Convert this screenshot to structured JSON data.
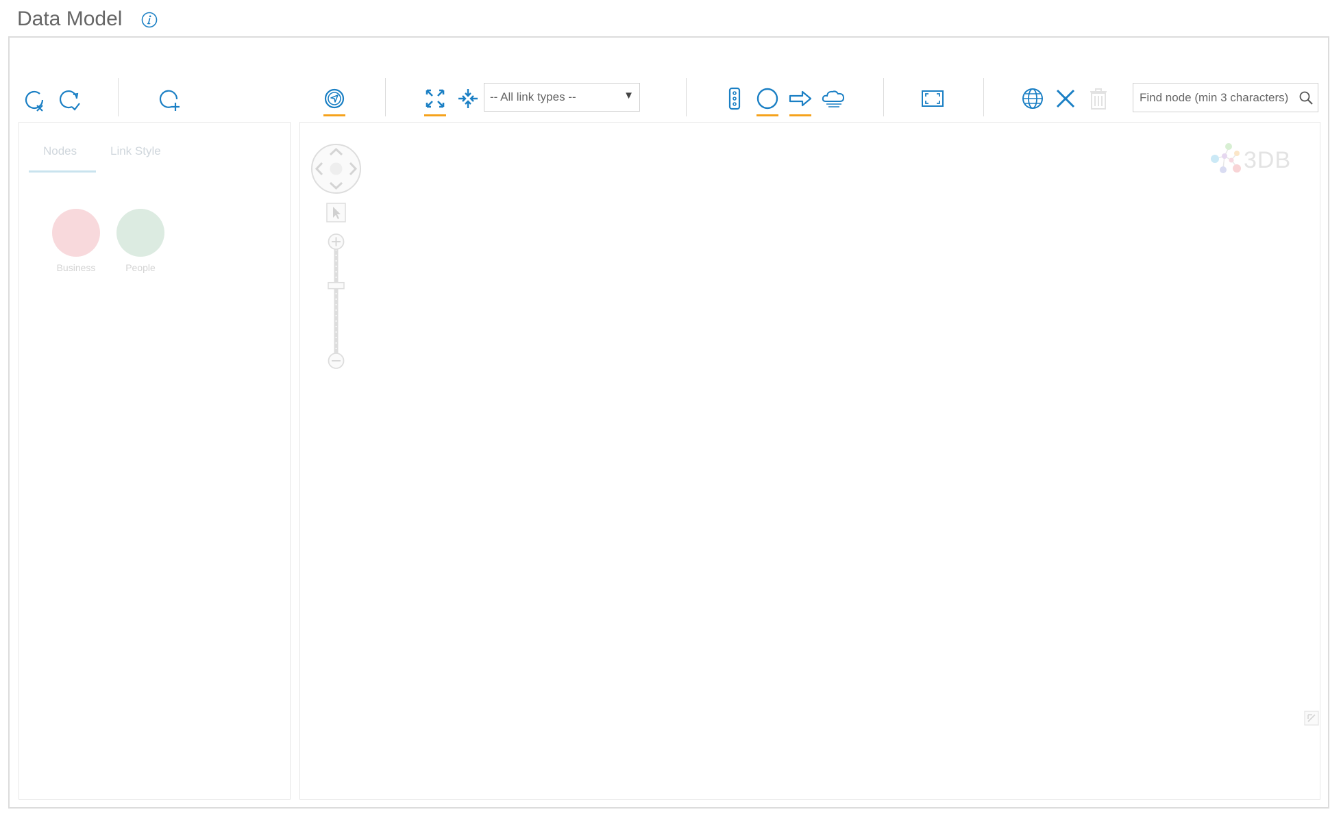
{
  "header": {
    "title": "Data Model",
    "info_icon": "info-icon"
  },
  "colors": {
    "icon_blue": "#1a7fc4",
    "active_underline": "#f5a21b",
    "border": "#dcdcdc",
    "business_node": "#f8d9dc",
    "people_node": "#dcebe1"
  },
  "toolbar": {
    "icons": [
      "deselect-all-icon",
      "select-all-icon",
      "add-node-icon",
      "navigate-icon",
      "expand-icon",
      "collapse-icon",
      "properties-panel-icon",
      "node-shape-icon",
      "link-arrow-icon",
      "cloud-icon",
      "fullscreen-icon",
      "globe-icon",
      "close-icon",
      "delete-icon"
    ],
    "link_type_select": {
      "selected": "--  All link types  --"
    },
    "search": {
      "placeholder": "Find node (min 3 characters)"
    }
  },
  "left_panel": {
    "tabs": [
      {
        "label": "Nodes",
        "active": true
      },
      {
        "label": "Link Style",
        "active": false
      }
    ],
    "legend": [
      {
        "label": "Business",
        "color": "#f8d9dc"
      },
      {
        "label": "People",
        "color": "#dcebe1"
      }
    ]
  },
  "canvas": {
    "logo_text": "3DB",
    "zoom_level": 0.65
  }
}
